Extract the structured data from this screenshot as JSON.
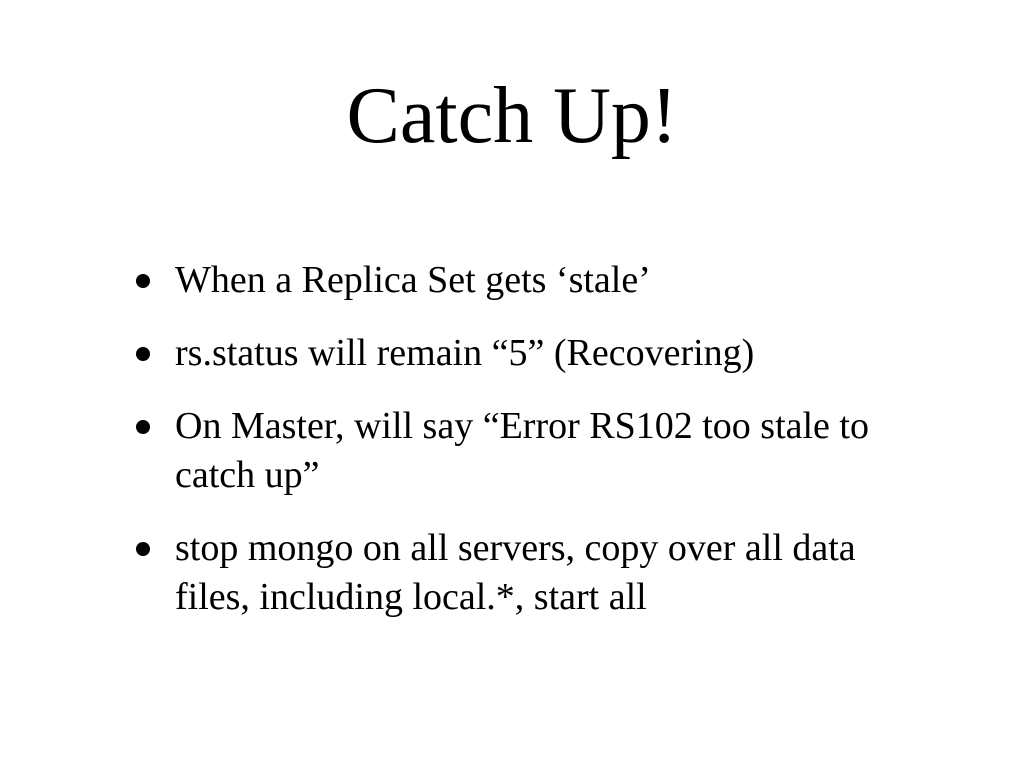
{
  "slide": {
    "title": "Catch Up!",
    "bullets": [
      "When a Replica Set gets ‘stale’",
      "rs.status will remain “5” (Recovering)",
      "On Master, will say “Error RS102 too stale to catch up”",
      "stop mongo on all servers, copy over all data files, including local.*, start all"
    ]
  }
}
